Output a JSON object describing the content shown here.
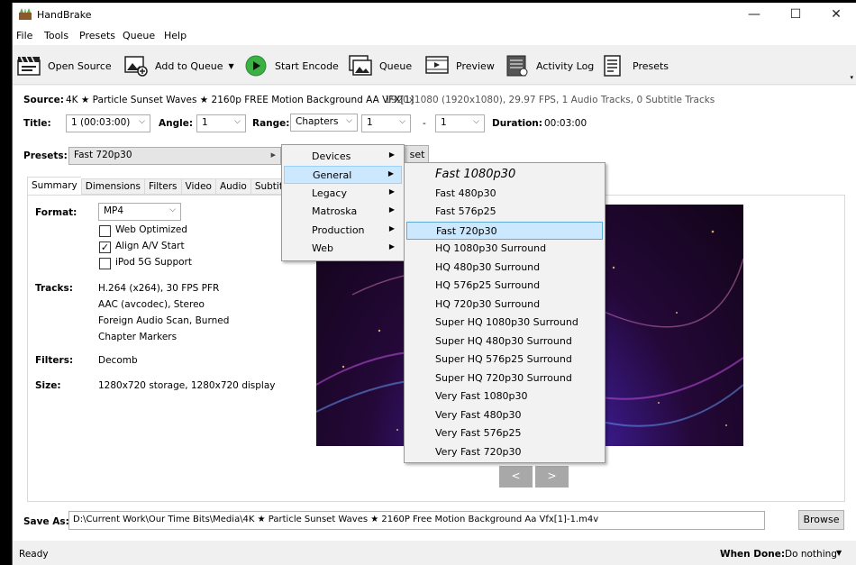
{
  "app": {
    "title": "HandBrake"
  },
  "window_controls": {
    "minimize": "—",
    "maximize": "☐",
    "close": "✕"
  },
  "menubar": [
    "File",
    "Tools",
    "Presets",
    "Queue",
    "Help"
  ],
  "toolbar": {
    "open_source": "Open Source",
    "add_to_queue": "Add to Queue",
    "start_encode": "Start Encode",
    "queue": "Queue",
    "preview": "Preview",
    "activity_log": "Activity Log",
    "presets": "Presets"
  },
  "source": {
    "label": "Source:",
    "name": "4K ★ Particle Sunset Waves ★ 2160p FREE Motion Background AA VFX[1]",
    "info": "1920x1080 (1920x1080), 29.97 FPS, 1 Audio Tracks, 0 Subtitle Tracks"
  },
  "title_row": {
    "title_label": "Title:",
    "title_value": "1 (00:03:00)",
    "angle_label": "Angle:",
    "angle_value": "1",
    "range_label": "Range:",
    "range_type": "Chapters",
    "range_start": "1",
    "range_sep": "-",
    "range_end": "1",
    "duration_label": "Duration:",
    "duration_value": "00:03:00"
  },
  "presets_row": {
    "label": "Presets:",
    "value": "Fast 720p30",
    "hidden_button": "set"
  },
  "tabs": [
    "Summary",
    "Dimensions",
    "Filters",
    "Video",
    "Audio",
    "Subtitle"
  ],
  "summary": {
    "format_label": "Format:",
    "format_value": "MP4",
    "web_optimized": "Web Optimized",
    "web_optimized_checked": false,
    "align_av": "Align A/V Start",
    "align_av_checked": true,
    "ipod": "iPod 5G Support",
    "ipod_checked": false,
    "tracks_label": "Tracks:",
    "tracks": [
      "H.264 (x264), 30 FPS PFR",
      "AAC (avcodec), Stereo",
      "Foreign Audio Scan, Burned",
      "Chapter Markers"
    ],
    "filters_label": "Filters:",
    "filters_value": "Decomb",
    "size_label": "Size:",
    "size_value": "1280x720 storage, 1280x720 display"
  },
  "preview_nav": {
    "prev": "<",
    "next": ">"
  },
  "preset_menu": {
    "categories": [
      "Devices",
      "General",
      "Legacy",
      "Matroska",
      "Production",
      "Web"
    ],
    "highlighted_category": "General",
    "general_items": [
      "Fast 1080p30",
      "Fast 480p30",
      "Fast 576p25",
      "Fast 720p30",
      "HQ 1080p30 Surround",
      "HQ 480p30 Surround",
      "HQ 576p25 Surround",
      "HQ 720p30 Surround",
      "Super HQ 1080p30 Surround",
      "Super HQ 480p30 Surround",
      "Super HQ 576p25 Surround",
      "Super HQ 720p30 Surround",
      "Very Fast 1080p30",
      "Very Fast 480p30",
      "Very Fast 576p25",
      "Very Fast 720p30"
    ],
    "highlighted_item": "Fast 720p30"
  },
  "save_as": {
    "label": "Save As:",
    "path": "D:\\Current Work\\Our Time Bits\\Media\\4K ★ Particle Sunset Waves ★ 2160P Free Motion Background Aa Vfx[1]-1.m4v",
    "browse": "Browse"
  },
  "status": {
    "text": "Ready",
    "when_done_label": "When Done:",
    "when_done_value": "Do nothing"
  },
  "colors": {
    "menu_highlight": "#cce8ff",
    "start_green": "#3cb043"
  }
}
